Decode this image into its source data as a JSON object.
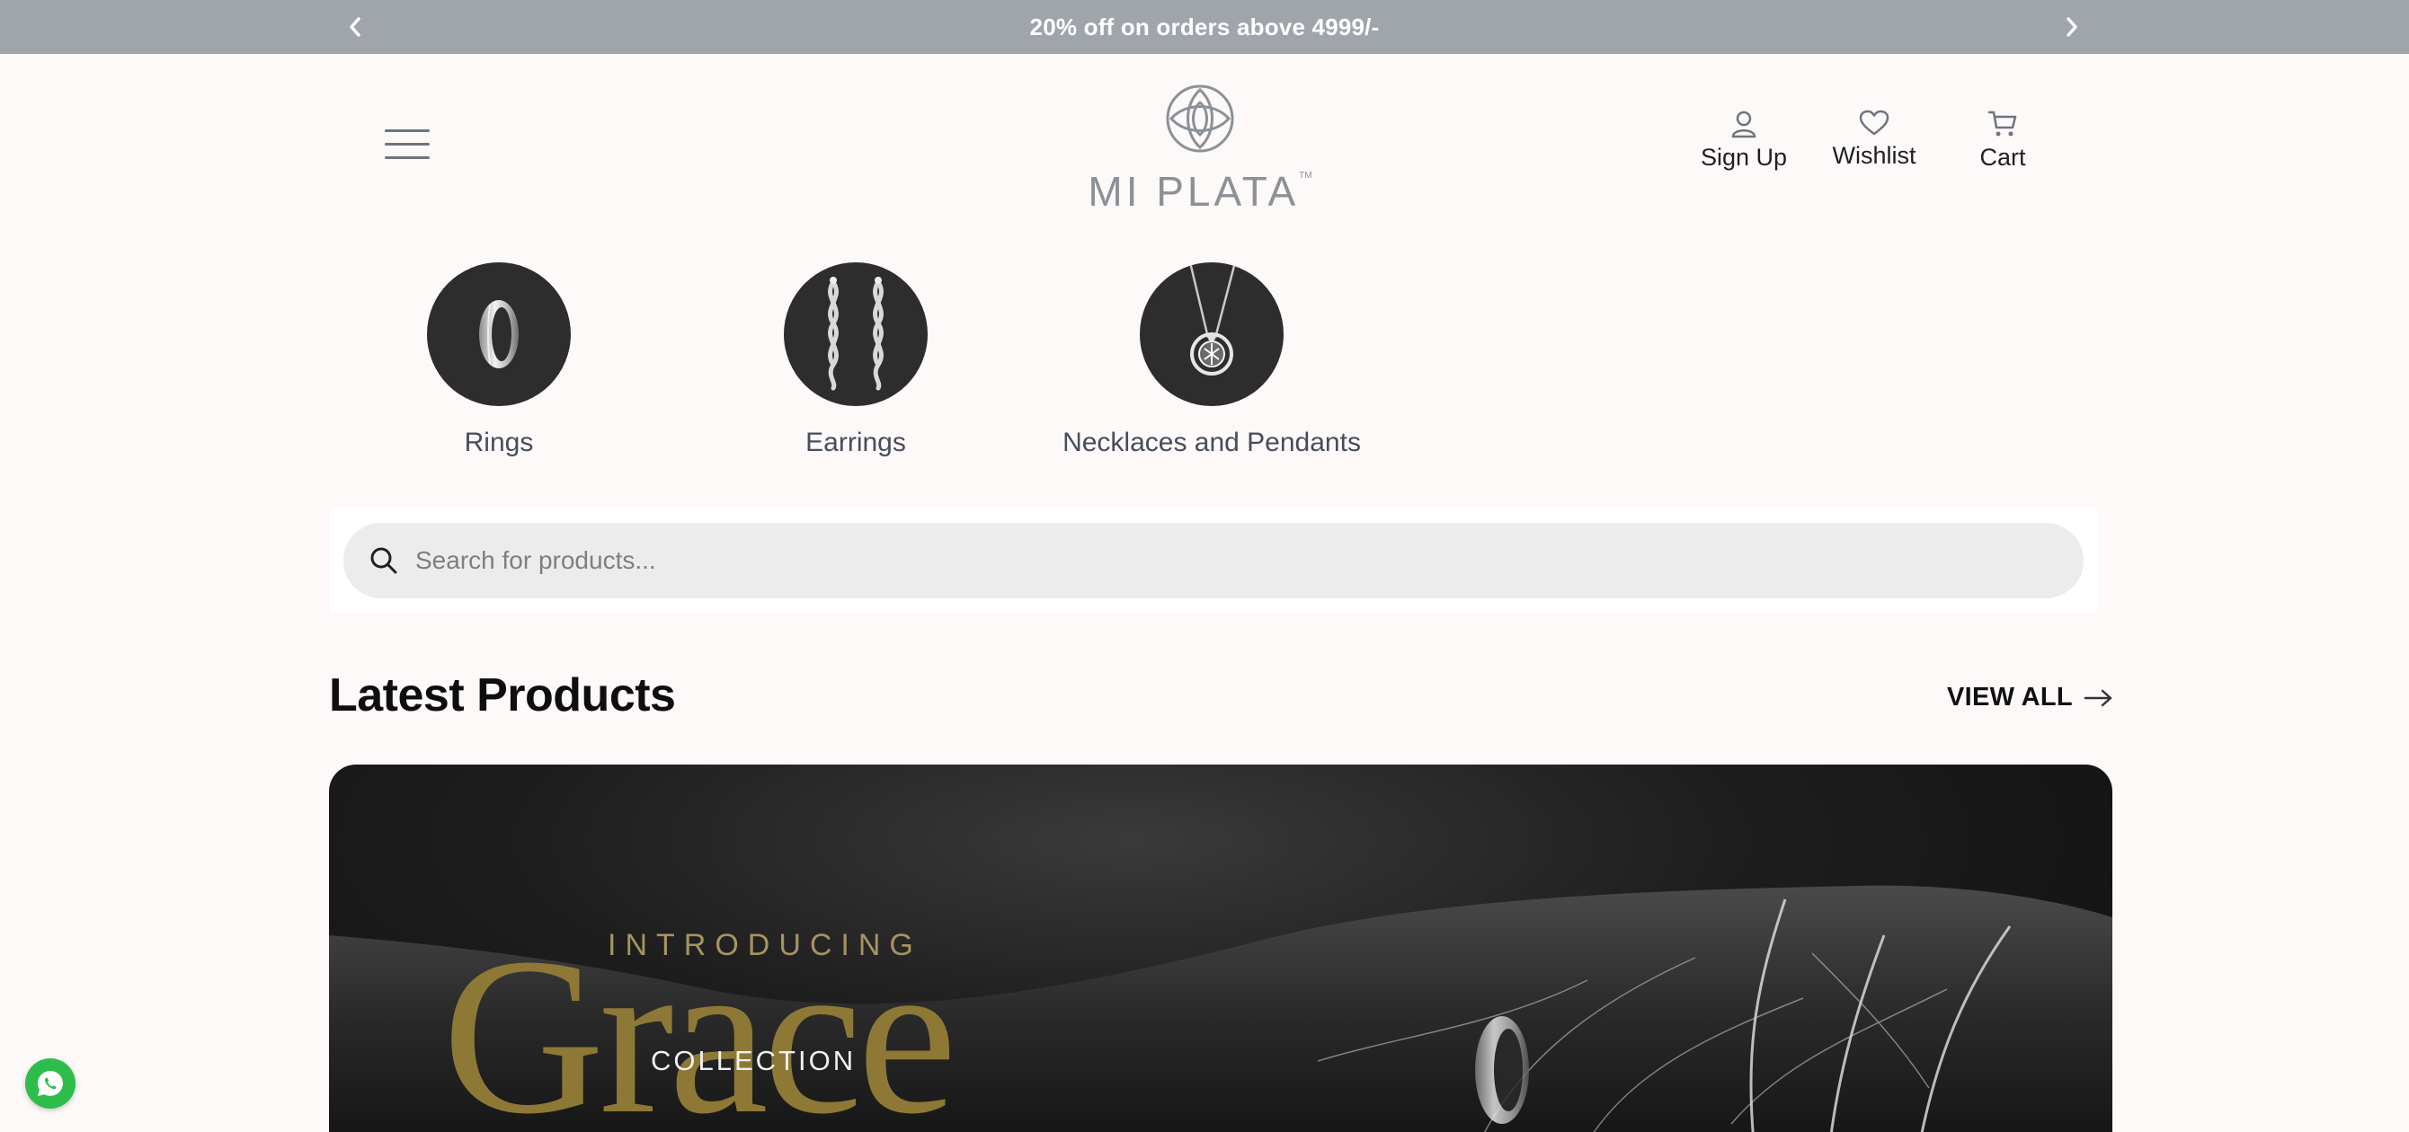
{
  "announcement": {
    "text": "20% off on orders above 4999/-",
    "prev_icon": "chevron-left-icon",
    "next_icon": "chevron-right-icon"
  },
  "header": {
    "menu_icon": "hamburger-menu-icon",
    "logo_text": "MI PLATA",
    "logo_tm": "TM",
    "actions": [
      {
        "label": "Sign Up",
        "icon": "user-icon"
      },
      {
        "label": "Wishlist",
        "icon": "heart-icon"
      },
      {
        "label": "Cart",
        "icon": "cart-icon"
      }
    ]
  },
  "categories": [
    {
      "label": "Rings",
      "icon": "ring-icon"
    },
    {
      "label": "Earrings",
      "icon": "earrings-icon"
    },
    {
      "label": "Necklaces and Pendants",
      "icon": "pendant-icon"
    }
  ],
  "search": {
    "placeholder": "Search for products...",
    "value": ""
  },
  "latest": {
    "title": "Latest Products",
    "view_all": "VIEW ALL"
  },
  "banner": {
    "intro": "INTRODUCING",
    "headline": "Grace",
    "sub": "COLLECTION"
  },
  "colors": {
    "announcement_bg": "#9fa5aa",
    "page_bg": "#fdf9f8",
    "category_circle": "#2d2d2e",
    "banner_gold": "#8d7836",
    "whatsapp_green": "#2ebd4b"
  }
}
